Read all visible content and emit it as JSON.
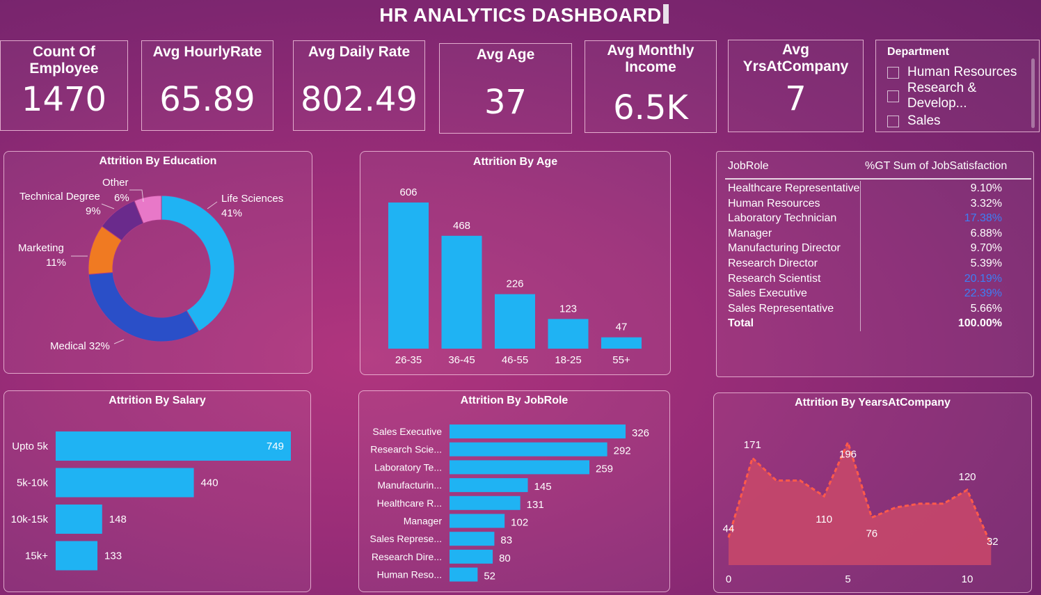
{
  "dashboard": {
    "title": "HR ANALYTICS DASHBOARD"
  },
  "kpis": [
    {
      "label": "Count Of Employee",
      "value": "1470"
    },
    {
      "label": "Avg HourlyRate",
      "value": "65.89"
    },
    {
      "label": "Avg Daily Rate",
      "value": "802.49"
    },
    {
      "label": "Avg Age",
      "value": "37"
    },
    {
      "label": "Avg Monthly Income",
      "value": "6.5K"
    },
    {
      "label": "Avg YrsAtCompany",
      "value": "7"
    }
  ],
  "department_slicer": {
    "title": "Department",
    "options": [
      "Human Resources",
      "Research & Develop...",
      "Sales"
    ]
  },
  "colors": {
    "bar": "#1fb3f3",
    "area_fill": "#c7476a",
    "area_line": "#ff5a4a",
    "highlight": "#3d7ff5"
  },
  "job_satisfaction_table": {
    "headers": [
      "JobRole",
      "%GT Sum of JobSatisfaction"
    ],
    "rows": [
      {
        "role": "Healthcare Representative",
        "pct": "9.10%",
        "highlight": false
      },
      {
        "role": "Human Resources",
        "pct": "3.32%",
        "highlight": false
      },
      {
        "role": "Laboratory Technician",
        "pct": "17.38%",
        "highlight": true
      },
      {
        "role": "Manager",
        "pct": "6.88%",
        "highlight": false
      },
      {
        "role": "Manufacturing Director",
        "pct": "9.70%",
        "highlight": false
      },
      {
        "role": "Research Director",
        "pct": "5.39%",
        "highlight": false
      },
      {
        "role": "Research Scientist",
        "pct": "20.19%",
        "highlight": true
      },
      {
        "role": "Sales Executive",
        "pct": "22.39%",
        "highlight": true
      },
      {
        "role": "Sales Representative",
        "pct": "5.66%",
        "highlight": false
      }
    ],
    "total_label": "Total",
    "total_value": "100.00%"
  },
  "chart_data": [
    {
      "id": "education",
      "type": "pie",
      "title": "Attrition By Education",
      "slices": [
        {
          "name": "Life Sciences",
          "label": "Life Sciences",
          "pct_label": "41%",
          "value": 41,
          "color": "#1fb3f3"
        },
        {
          "name": "Medical",
          "label": "Medical 32%",
          "pct_label": "",
          "value": 32,
          "color": "#2a4fc8"
        },
        {
          "name": "Marketing",
          "label": "Marketing",
          "pct_label": "11%",
          "value": 11,
          "color": "#f07a22"
        },
        {
          "name": "Technical Degree",
          "label": "Technical Degree",
          "pct_label": "9%",
          "value": 9,
          "color": "#6a2a8c"
        },
        {
          "name": "Other",
          "label": "Other",
          "pct_label": "6%",
          "value": 6,
          "color": "#e878c8"
        }
      ]
    },
    {
      "id": "age",
      "type": "bar",
      "title": "Attrition By Age",
      "categories": [
        "26-35",
        "36-45",
        "46-55",
        "18-25",
        "55+"
      ],
      "values": [
        606,
        468,
        226,
        123,
        47
      ],
      "ylim": [
        0,
        606
      ]
    },
    {
      "id": "salary",
      "type": "bar",
      "orientation": "horizontal",
      "title": "Attrition By Salary",
      "categories": [
        "Upto 5k",
        "5k-10k",
        "10k-15k",
        "15k+"
      ],
      "values": [
        749,
        440,
        148,
        133
      ],
      "xlim": [
        0,
        749
      ]
    },
    {
      "id": "jobrole",
      "type": "bar",
      "orientation": "horizontal",
      "title": "Attrition By JobRole",
      "categories": [
        "Sales Executive",
        "Research Scie...",
        "Laboratory Te...",
        "Manufacturin...",
        "Healthcare R...",
        "Manager",
        "Sales Represe...",
        "Research Dire...",
        "Human Reso..."
      ],
      "values": [
        326,
        292,
        259,
        145,
        131,
        102,
        83,
        80,
        52
      ],
      "xlim": [
        0,
        326
      ]
    },
    {
      "id": "years",
      "type": "area",
      "title": "Attrition By YearsAtCompany",
      "x": [
        0,
        1,
        2,
        3,
        4,
        5,
        6,
        7,
        8,
        9,
        10,
        11
      ],
      "values": [
        44,
        171,
        135,
        135,
        110,
        196,
        76,
        92,
        98,
        98,
        120,
        32
      ],
      "point_labels": {
        "0": "44",
        "1": "171",
        "4": "110",
        "5": "196",
        "6": "76",
        "10": "120",
        "11": "32"
      },
      "xticks": [
        "0",
        "5",
        "10"
      ],
      "ylim": [
        0,
        220
      ]
    }
  ]
}
